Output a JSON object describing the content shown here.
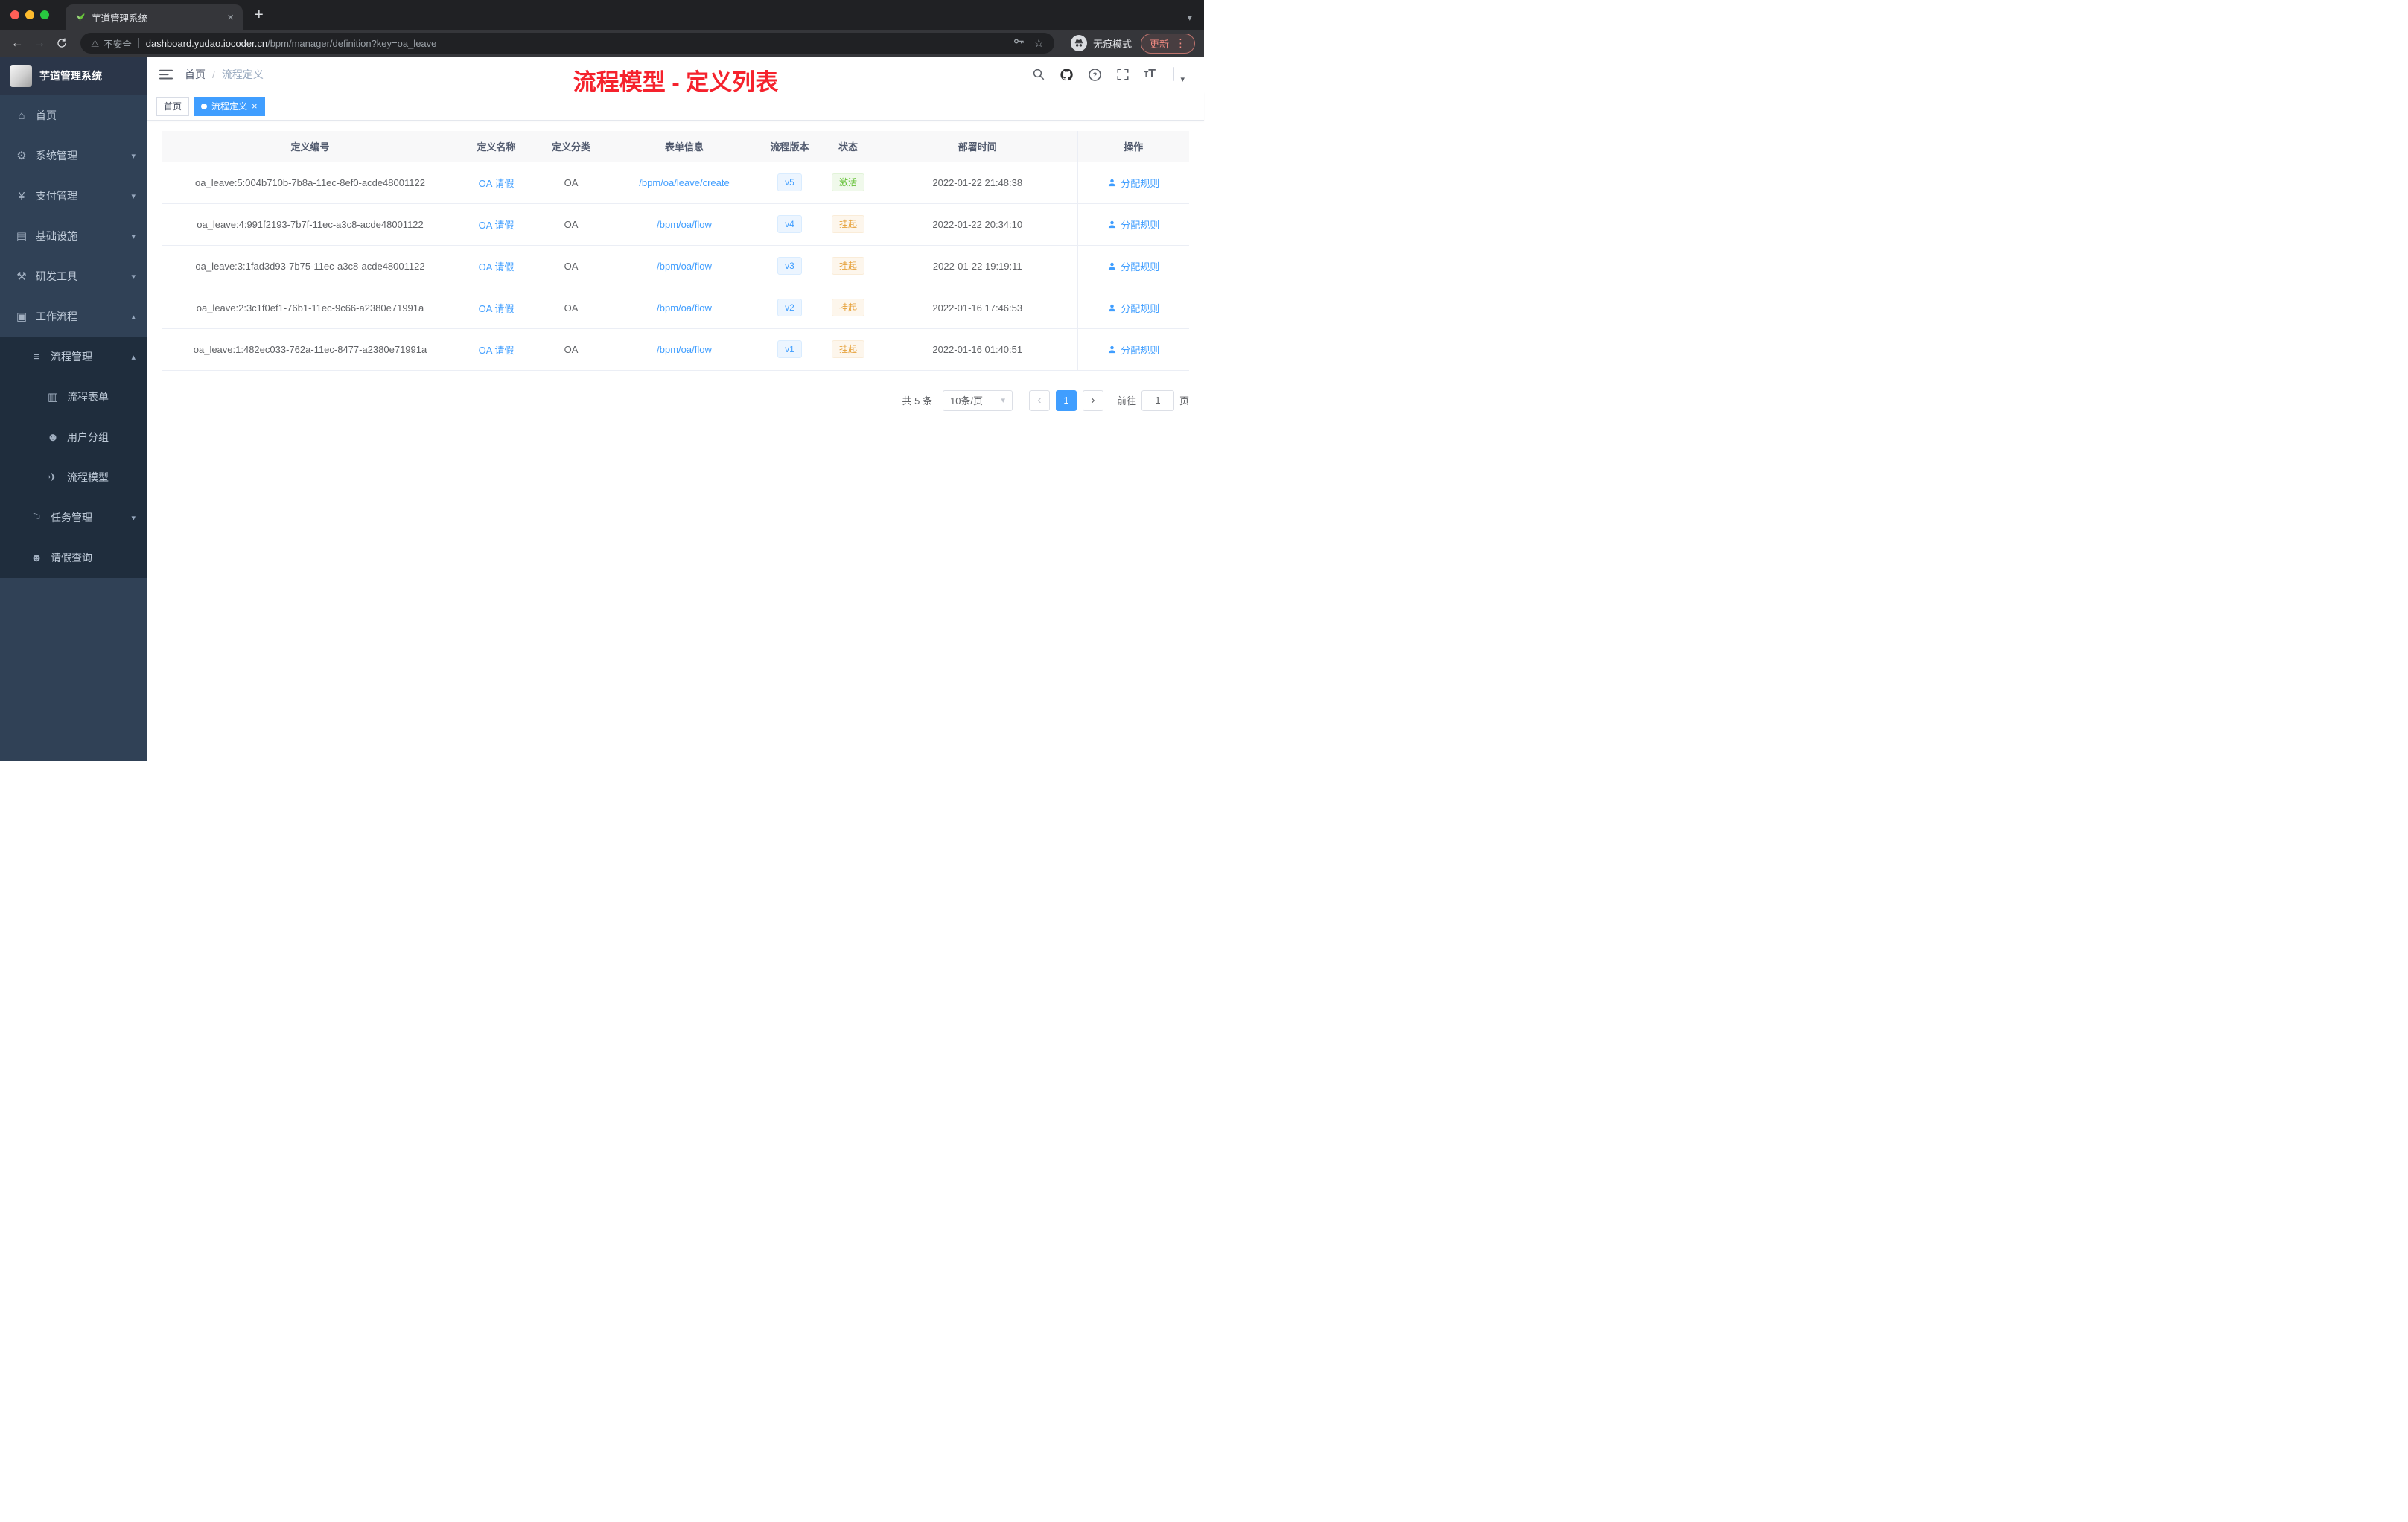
{
  "colors": {
    "accent": "#409eff",
    "success": "#67c23a",
    "warning": "#e6a23c",
    "annotation_red": "#f5222d",
    "sidebar_bg": "#304156",
    "submenu_bg": "#1f2d3d"
  },
  "icons": {
    "caret_down": "▾"
  },
  "browser": {
    "tab": {
      "title": "芋道管理系统",
      "close": "×",
      "new_tab": "+",
      "caret": "▾"
    },
    "toolbar": {
      "back": "←",
      "forward": "→",
      "warning": "⚠",
      "security_label": "不安全",
      "url_host": "dashboard.yudao.iocoder.cn",
      "url_path": "/bpm/manager/definition?key=oa_leave",
      "star": "☆",
      "incognito_label": "无痕模式",
      "update_label": "更新",
      "menu_dots": "⋮"
    }
  },
  "sidebar": {
    "logo_title": "芋道管理系统",
    "items": [
      {
        "label": "首页",
        "icon": "⌂"
      },
      {
        "label": "系统管理",
        "icon": "⚙",
        "arrow": "▾"
      },
      {
        "label": "支付管理",
        "icon": "¥",
        "arrow": "▾"
      },
      {
        "label": "基础设施",
        "icon": "▤",
        "arrow": "▾"
      },
      {
        "label": "研发工具",
        "icon": "⚒",
        "arrow": "▾"
      },
      {
        "label": "工作流程",
        "icon": "▣",
        "arrow": "▴"
      },
      {
        "label": "流程管理",
        "icon": "≡",
        "arrow": "▴"
      },
      {
        "label": "流程表单",
        "icon": "▥"
      },
      {
        "label": "用户分组",
        "icon": "☻"
      },
      {
        "label": "流程模型",
        "icon": "✈"
      },
      {
        "label": "任务管理",
        "icon": "⚐",
        "arrow": "▾"
      },
      {
        "label": "请假查询",
        "icon": "☻"
      }
    ]
  },
  "header": {
    "breadcrumb": {
      "home": "首页",
      "separator": "/",
      "current": "流程定义"
    },
    "annotation": "流程模型 - 定义列表",
    "font_size_icon": "T"
  },
  "tags": {
    "home": "首页",
    "active": "流程定义",
    "close": "×"
  },
  "table": {
    "columns": [
      "定义编号",
      "定义名称",
      "定义分类",
      "表单信息",
      "流程版本",
      "状态",
      "部署时间",
      "操作"
    ],
    "rows": [
      {
        "id": "oa_leave:5:004b710b-7b8a-11ec-8ef0-acde48001122",
        "name": "OA 请假",
        "category": "OA",
        "form": "/bpm/oa/leave/create",
        "version": "v5",
        "status": "激活",
        "time": "2022-01-22 21:48:38",
        "action": "分配规则"
      },
      {
        "id": "oa_leave:4:991f2193-7b7f-11ec-a3c8-acde48001122",
        "name": "OA 请假",
        "category": "OA",
        "form": "/bpm/oa/flow",
        "version": "v4",
        "status": "挂起",
        "time": "2022-01-22 20:34:10",
        "action": "分配规则"
      },
      {
        "id": "oa_leave:3:1fad3d93-7b75-11ec-a3c8-acde48001122",
        "name": "OA 请假",
        "category": "OA",
        "form": "/bpm/oa/flow",
        "version": "v3",
        "status": "挂起",
        "time": "2022-01-22 19:19:11",
        "action": "分配规则"
      },
      {
        "id": "oa_leave:2:3c1f0ef1-76b1-11ec-9c66-a2380e71991a",
        "name": "OA 请假",
        "category": "OA",
        "form": "/bpm/oa/flow",
        "version": "v2",
        "status": "挂起",
        "time": "2022-01-16 17:46:53",
        "action": "分配规则"
      },
      {
        "id": "oa_leave:1:482ec033-762a-11ec-8477-a2380e71991a",
        "name": "OA 请假",
        "category": "OA",
        "form": "/bpm/oa/flow",
        "version": "v1",
        "status": "挂起",
        "time": "2022-01-16 01:40:51",
        "action": "分配规则"
      }
    ]
  },
  "pagination": {
    "total": "共 5 条",
    "page_size": "10条/页",
    "prev": "‹",
    "next": "›",
    "page": "1",
    "goto_label": "前往",
    "goto_value": "1",
    "page_unit": "页"
  }
}
